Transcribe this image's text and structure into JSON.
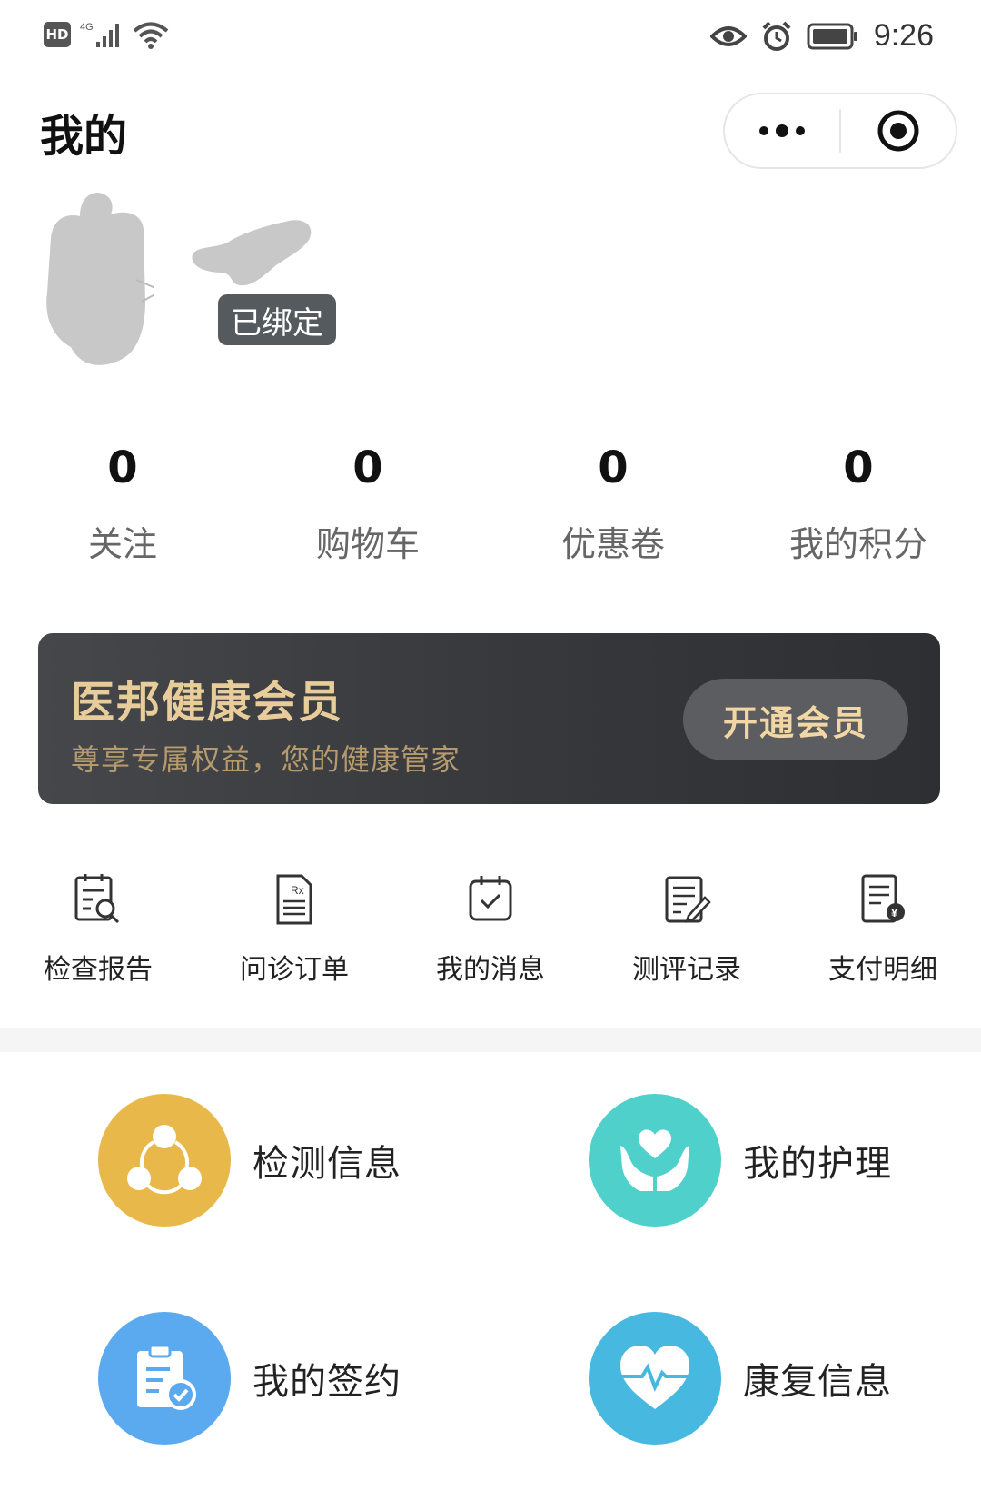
{
  "status": {
    "network": "4G",
    "time": "9:26"
  },
  "header": {
    "title": "我的"
  },
  "profile": {
    "bind_badge": "已绑定"
  },
  "stats": [
    {
      "value": "0",
      "label": "关注"
    },
    {
      "value": "0",
      "label": "购物车"
    },
    {
      "value": "0",
      "label": "优惠卷"
    },
    {
      "value": "0",
      "label": "我的积分"
    }
  ],
  "member": {
    "title": "医邦健康会员",
    "subtitle": "尊享专属权益，您的健康管家",
    "button": "开通会员"
  },
  "quick": [
    {
      "label": "检查报告",
      "icon": "report-search-icon"
    },
    {
      "label": "问诊订单",
      "icon": "prescription-icon"
    },
    {
      "label": "我的消息",
      "icon": "calendar-check-icon"
    },
    {
      "label": "测评记录",
      "icon": "edit-record-icon"
    },
    {
      "label": "支付明细",
      "icon": "payment-bill-icon"
    }
  ],
  "services": [
    {
      "label": "检测信息",
      "icon": "share-nodes-icon",
      "color": "#E8B84A"
    },
    {
      "label": "我的护理",
      "icon": "heart-hands-icon",
      "color": "#4FD0CA"
    },
    {
      "label": "我的签约",
      "icon": "clipboard-check-icon",
      "color": "#5BAAF0"
    },
    {
      "label": "康复信息",
      "icon": "heartbeat-icon",
      "color": "#47B8E0"
    }
  ]
}
